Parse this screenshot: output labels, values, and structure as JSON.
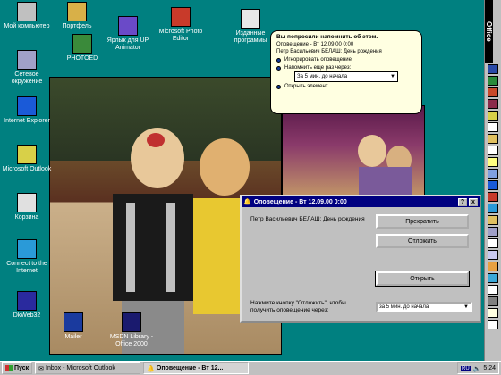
{
  "desktop_icons": [
    {
      "label": "Мой компьютер",
      "icon": "my-computer-icon",
      "color": "#c0c0c0"
    },
    {
      "label": "Портфель",
      "icon": "briefcase-icon",
      "color": "#d8b048"
    },
    {
      "label": "Ярлык для UP Animator",
      "icon": "shortcut-icon",
      "color": "#6a4ac8"
    },
    {
      "label": "Microsoft Photo Editor",
      "icon": "photo-editor-icon",
      "color": "#c83a2a"
    },
    {
      "label": "Изданные программы",
      "icon": "programs-icon",
      "color": "#e8e8e8"
    },
    {
      "label": "PHOTOED",
      "icon": "photoed-icon",
      "color": "#3a8a3a"
    },
    {
      "label": "Сетевое окружение",
      "icon": "network-icon",
      "color": "#a0a0c8"
    },
    {
      "label": "Internet Explorer",
      "icon": "ie-icon",
      "color": "#1a5ad8"
    },
    {
      "label": "Microsoft Outlook",
      "icon": "outlook-icon",
      "color": "#d8d048"
    },
    {
      "label": "Корзина",
      "icon": "recycle-bin-icon",
      "color": "#e0e0e0"
    },
    {
      "label": "Connect to the Internet",
      "icon": "connect-icon",
      "color": "#2a9ad8"
    },
    {
      "label": "DkWeb32",
      "icon": "dkweb-icon",
      "color": "#2a2a9e"
    },
    {
      "label": "Mailer",
      "icon": "mailer-icon",
      "color": "#1a3a9e"
    },
    {
      "label": "MSDN Library - Office 2000",
      "icon": "msdn-icon",
      "color": "#1a1a6e"
    }
  ],
  "balloon": {
    "title": "Вы попросили напомнить об этом.",
    "subtitle": "Оповещение - Вт 12.09.00 0:00",
    "subject": "Петр Васильевич БЕЛАШ: День рождения",
    "options": [
      "Игнорировать оповещение",
      "Напомнить еще раз через:"
    ],
    "select_value": "За 5 мин. до начала",
    "open_label": "Открыть элемент"
  },
  "dialog": {
    "title": "Оповещение - Вт 12.09.00 0:00",
    "subject": "Петр Васильевич БЕЛАШ: День рождения",
    "help_btn": "?",
    "close_btn": "x",
    "dismiss": "Прекратить",
    "postpone": "Отложить",
    "open": "Открыть",
    "snooze_text": "Нажмите кнопку \"Отложить\", чтобы получить оповещение через:",
    "snooze_value": "за 5 мин. до начала"
  },
  "office_bar": {
    "label": "Office"
  },
  "taskbar": {
    "start": "Пуск",
    "items": [
      "Inbox - Microsoft Outlook",
      "Оповещение - Вт 12..."
    ],
    "lang": "RU",
    "time": "5:24"
  }
}
